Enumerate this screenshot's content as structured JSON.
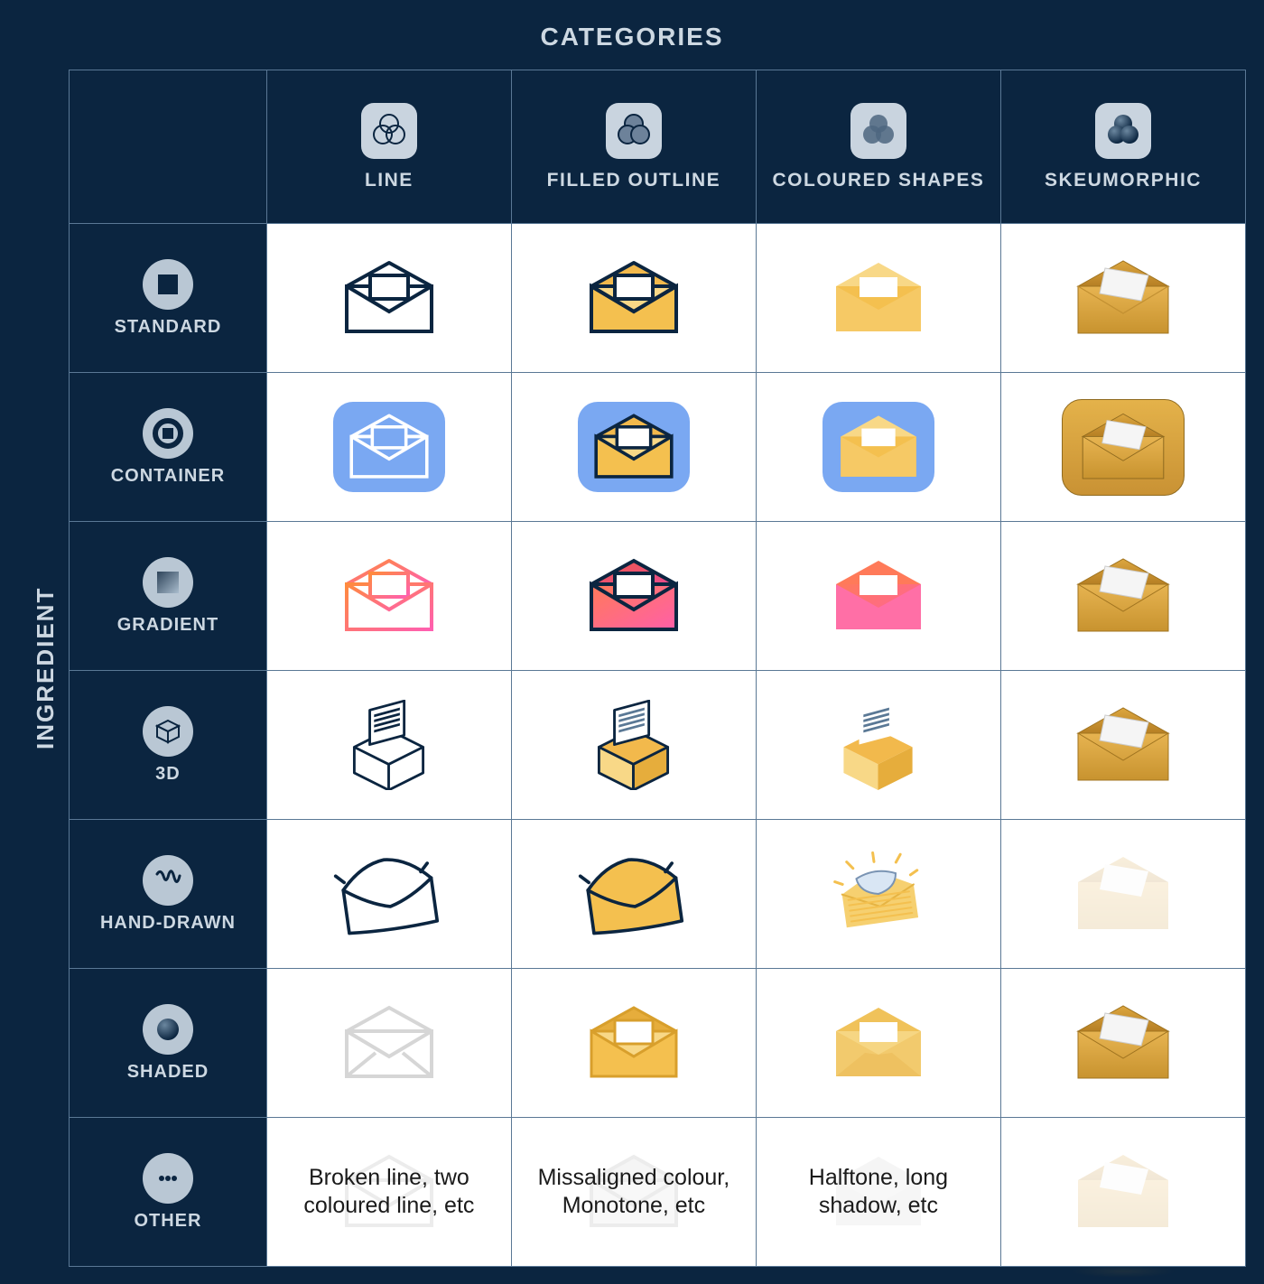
{
  "titles": {
    "top": "CATEGORIES",
    "side": "INGREDIENT"
  },
  "columns": [
    {
      "key": "line",
      "label": "LINE",
      "style": "outline"
    },
    {
      "key": "filled_outline",
      "label": "FILLED OUTLINE",
      "style": "filled-outline"
    },
    {
      "key": "coloured_shapes",
      "label": "COLOURED SHAPES",
      "style": "coloured"
    },
    {
      "key": "skeumorphic",
      "label": "SKEUMORPHIC",
      "style": "skeu"
    }
  ],
  "rows": [
    {
      "key": "standard",
      "label": "STANDARD",
      "icon": "square"
    },
    {
      "key": "container",
      "label": "CONTAINER",
      "icon": "square-in-ring"
    },
    {
      "key": "gradient",
      "label": "GRADIENT",
      "icon": "gradient-square"
    },
    {
      "key": "3d",
      "label": "3D",
      "icon": "cube"
    },
    {
      "key": "hand_drawn",
      "label": "HAND-DRAWN",
      "icon": "scribble"
    },
    {
      "key": "shaded",
      "label": "SHADED",
      "icon": "sphere"
    },
    {
      "key": "other",
      "label": "OTHER",
      "icon": "dots"
    }
  ],
  "other_text": {
    "line": "Broken line, two coloured line, etc",
    "filled_outline": "Missaligned colour, Monotone, etc",
    "coloured_shapes": "Halftone, long shadow, etc",
    "skeumorphic": ""
  }
}
